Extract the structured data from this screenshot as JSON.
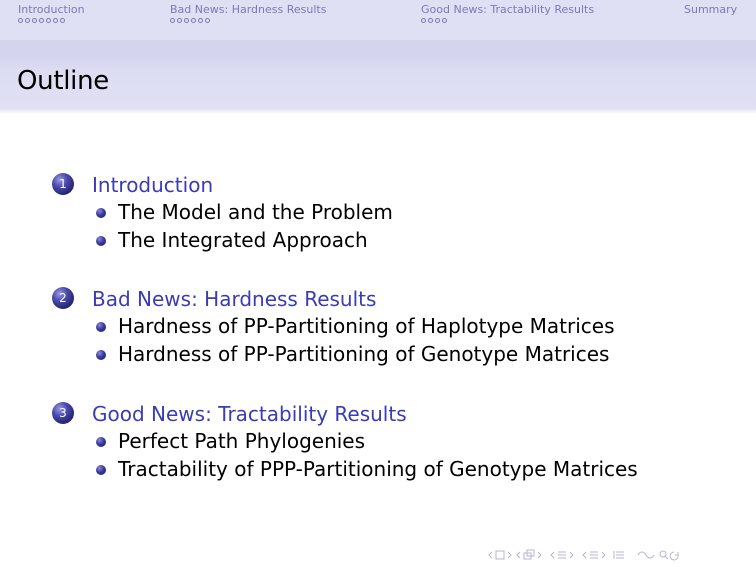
{
  "headline": {
    "sections": [
      {
        "label": "Introduction",
        "dots": 7
      },
      {
        "label": "Bad News: Hardness Results",
        "dots": 6
      },
      {
        "label": "Good News: Tractability Results",
        "dots": 4
      },
      {
        "label": "Summary",
        "dots": 0
      }
    ]
  },
  "frame": {
    "title": "Outline"
  },
  "toc": [
    {
      "number": "1",
      "title": "Introduction",
      "subsections": [
        "The Model and the Problem",
        "The Integrated Approach"
      ]
    },
    {
      "number": "2",
      "title": "Bad News: Hardness Results",
      "subsections": [
        "Hardness of PP-Partitioning of Haplotype Matrices",
        "Hardness of PP-Partitioning of Genotype Matrices"
      ]
    },
    {
      "number": "3",
      "title": "Good News: Tractability Results",
      "subsections": [
        "Perfect Path Phylogenies",
        "Tractability of PPP-Partitioning of Genotype Matrices"
      ]
    }
  ],
  "navigation_symbols": {
    "icons": [
      "first-arrow-icon",
      "frame-icon",
      "prev-next-frame-icon",
      "subsection-icon",
      "section-icon",
      "toc-icon",
      "search-icon"
    ]
  }
}
